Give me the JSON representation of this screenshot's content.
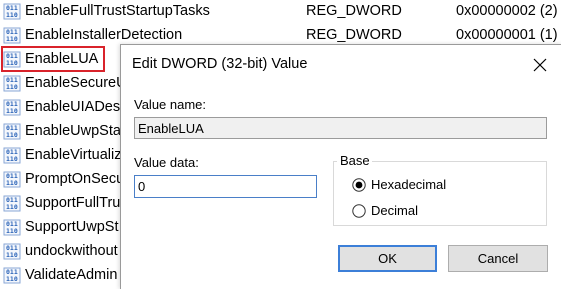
{
  "registry": {
    "rows": [
      {
        "name": "EnableFullTrustStartupTasks",
        "type": "REG_DWORD",
        "data": "0x00000002 (2)"
      },
      {
        "name": "EnableInstallerDetection",
        "type": "REG_DWORD",
        "data": "0x00000001 (1)"
      },
      {
        "name": "EnableLUA",
        "type": "",
        "data": ""
      },
      {
        "name": "EnableSecureU",
        "type": "",
        "data": ""
      },
      {
        "name": "EnableUIADes",
        "type": "",
        "data": ""
      },
      {
        "name": "EnableUwpSta",
        "type": "",
        "data": ""
      },
      {
        "name": "EnableVirtualiz",
        "type": "",
        "data": ""
      },
      {
        "name": "PromptOnSecu",
        "type": "",
        "data": ""
      },
      {
        "name": "SupportFullTru",
        "type": "",
        "data": ""
      },
      {
        "name": "SupportUwpSt",
        "type": "",
        "data": ""
      },
      {
        "name": "undockwithout",
        "type": "",
        "data": ""
      },
      {
        "name": "ValidateAdmin",
        "type": "",
        "data": ""
      }
    ]
  },
  "dialog": {
    "title": "Edit DWORD (32-bit) Value",
    "value_name_label": "Value name:",
    "value_name": "EnableLUA",
    "value_data_label": "Value data:",
    "value_data": "0",
    "base_label": "Base",
    "hex_label": "Hexadecimal",
    "dec_label": "Decimal",
    "selected_base": "Hexadecimal",
    "ok_label": "OK",
    "cancel_label": "Cancel"
  },
  "colors": {
    "selection_border": "#d9232b",
    "ok_border": "#3c7fd8",
    "icon_blue": "#2a63b8"
  },
  "icons": {
    "registry_value": "reg-binary-icon",
    "close": "close-icon"
  }
}
